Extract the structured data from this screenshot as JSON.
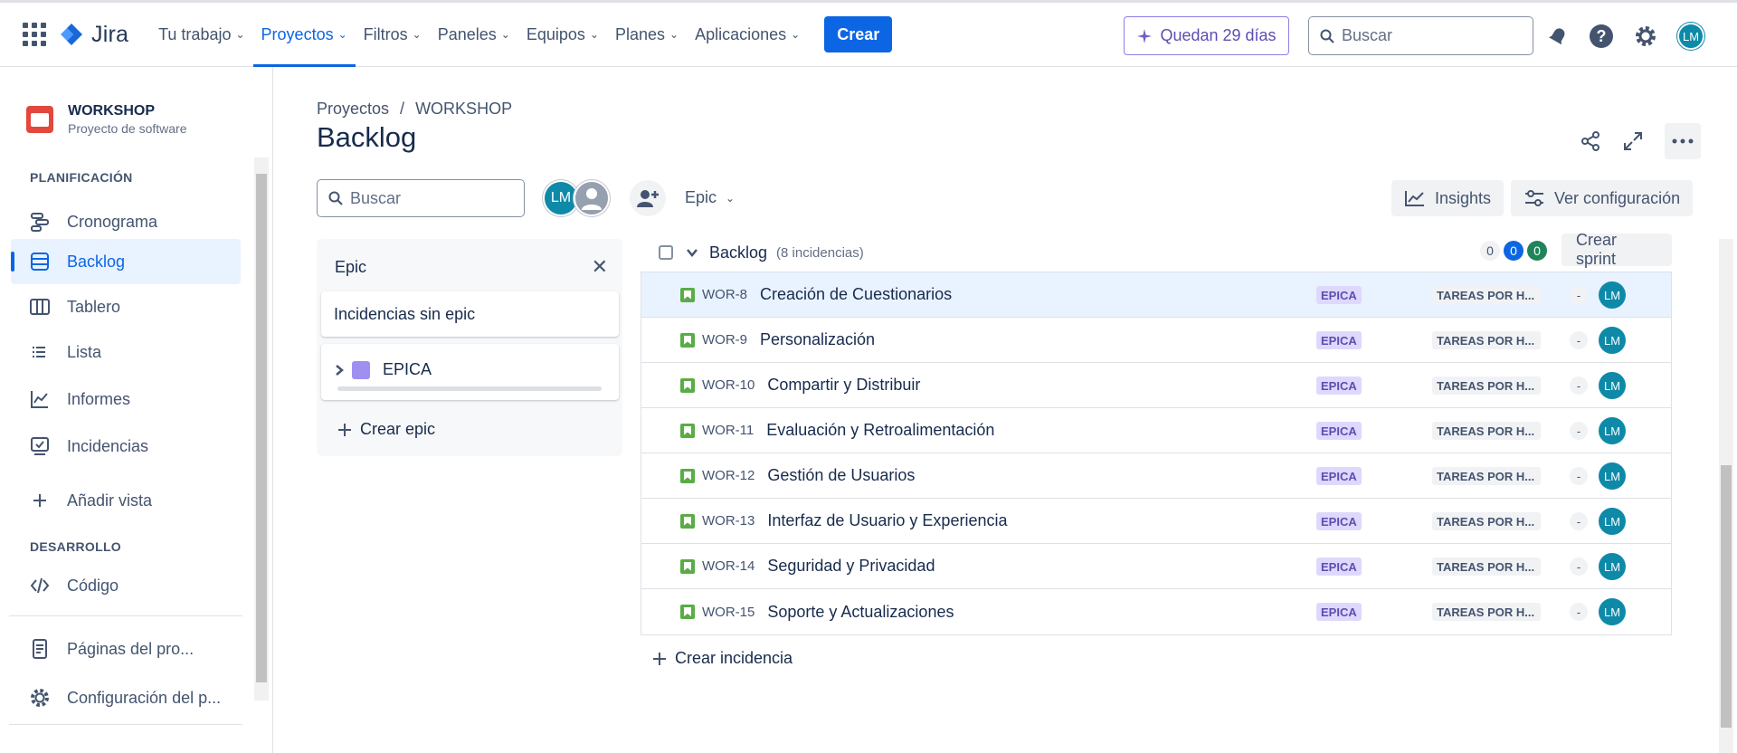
{
  "app": {
    "name": "Jira"
  },
  "nav": {
    "items": [
      {
        "label": "Tu trabajo",
        "active": false
      },
      {
        "label": "Proyectos",
        "active": true
      },
      {
        "label": "Filtros",
        "active": false
      },
      {
        "label": "Paneles",
        "active": false
      },
      {
        "label": "Equipos",
        "active": false
      },
      {
        "label": "Planes",
        "active": false
      },
      {
        "label": "Aplicaciones",
        "active": false
      }
    ],
    "create_label": "Crear",
    "trial_label": "Quedan 29 días",
    "search_placeholder": "Buscar",
    "avatar_initials": "LM"
  },
  "sidebar": {
    "project_name": "WORKSHOP",
    "project_type": "Proyecto de software",
    "planning_label": "PLANIFICACIÓN",
    "planning_items": [
      {
        "label": "Cronograma",
        "icon": "timeline-icon"
      },
      {
        "label": "Backlog",
        "icon": "backlog-icon",
        "active": true
      },
      {
        "label": "Tablero",
        "icon": "board-icon"
      },
      {
        "label": "Lista",
        "icon": "list-icon"
      },
      {
        "label": "Informes",
        "icon": "reports-icon"
      },
      {
        "label": "Incidencias",
        "icon": "issues-icon"
      }
    ],
    "add_view_label": "Añadir vista",
    "dev_label": "DESARROLLO",
    "code_label": "Código",
    "pages_label": "Páginas del pro...",
    "settings_label": "Configuración del p..."
  },
  "page": {
    "breadcrumb": [
      "Proyectos",
      "WORKSHOP"
    ],
    "breadcrumb_sep": "/",
    "title": "Backlog"
  },
  "toolbar": {
    "search_placeholder": "Buscar",
    "avatar_initials": "LM",
    "epic_filter_label": "Epic",
    "insights_label": "Insights",
    "config_label": "Ver configuración"
  },
  "epic_panel": {
    "title": "Epic",
    "no_epic_label": "Incidencias sin epic",
    "epic_name": "EPICA",
    "epic_color": "#9f8fef",
    "create_label": "Crear epic"
  },
  "backlog": {
    "name": "Backlog",
    "count_label": "(8 incidencias)",
    "counters": [
      "0",
      "0",
      "0"
    ],
    "create_sprint_label": "Crear sprint",
    "issues": [
      {
        "key": "WOR-8",
        "summary": "Creación de Cuestionarios",
        "epic": "EPICA",
        "status": "TAREAS POR H...",
        "estimate": "-",
        "assignee": "LM",
        "selected": true
      },
      {
        "key": "WOR-9",
        "summary": "Personalización",
        "epic": "EPICA",
        "status": "TAREAS POR H...",
        "estimate": "-",
        "assignee": "LM"
      },
      {
        "key": "WOR-10",
        "summary": "Compartir y Distribuir",
        "epic": "EPICA",
        "status": "TAREAS POR H...",
        "estimate": "-",
        "assignee": "LM"
      },
      {
        "key": "WOR-11",
        "summary": "Evaluación y Retroalimentación",
        "epic": "EPICA",
        "status": "TAREAS POR H...",
        "estimate": "-",
        "assignee": "LM"
      },
      {
        "key": "WOR-12",
        "summary": "Gestión de Usuarios",
        "epic": "EPICA",
        "status": "TAREAS POR H...",
        "estimate": "-",
        "assignee": "LM"
      },
      {
        "key": "WOR-13",
        "summary": "Interfaz de Usuario y Experiencia",
        "epic": "EPICA",
        "status": "TAREAS POR H...",
        "estimate": "-",
        "assignee": "LM"
      },
      {
        "key": "WOR-14",
        "summary": "Seguridad y Privacidad",
        "epic": "EPICA",
        "status": "TAREAS POR H...",
        "estimate": "-",
        "assignee": "LM"
      },
      {
        "key": "WOR-15",
        "summary": "Soporte y Actualizaciones",
        "epic": "EPICA",
        "status": "TAREAS POR H...",
        "estimate": "-",
        "assignee": "LM"
      }
    ],
    "create_issue_label": "Crear incidencia"
  }
}
